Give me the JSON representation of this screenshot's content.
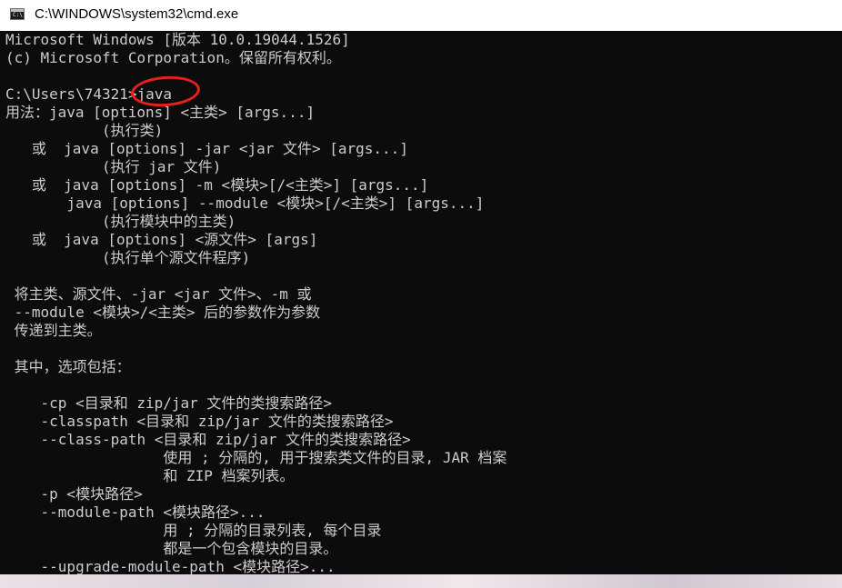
{
  "window": {
    "title": "C:\\WINDOWS\\system32\\cmd.exe",
    "icon": "cmd-icon",
    "icon_text": "C:\\"
  },
  "console": {
    "lines": [
      "Microsoft Windows [版本 10.0.19044.1526]",
      "(c) Microsoft Corporation。保留所有权利。",
      "",
      "C:\\Users\\74321>java",
      "用法：java [options] <主类> [args...]",
      "           (执行类)",
      "   或  java [options] -jar <jar 文件> [args...]",
      "           (执行 jar 文件)",
      "   或  java [options] -m <模块>[/<主类>] [args...]",
      "       java [options] --module <模块>[/<主类>] [args...]",
      "           (执行模块中的主类)",
      "   或  java [options] <源文件> [args]",
      "           (执行单个源文件程序)",
      "",
      " 将主类、源文件、-jar <jar 文件>、-m 或",
      " --module <模块>/<主类> 后的参数作为参数",
      " 传递到主类。",
      "",
      " 其中，选项包括：",
      "",
      "    -cp <目录和 zip/jar 文件的类搜索路径>",
      "    -classpath <目录和 zip/jar 文件的类搜索路径>",
      "    --class-path <目录和 zip/jar 文件的类搜索路径>",
      "                  使用 ; 分隔的, 用于搜索类文件的目录, JAR 档案",
      "                  和 ZIP 档案列表。",
      "    -p <模块路径>",
      "    --module-path <模块路径>...",
      "                  用 ; 分隔的目录列表, 每个目录",
      "                  都是一个包含模块的目录。",
      "    --upgrade-module-path <模块路径>..."
    ]
  },
  "annotation": {
    "color": "#e8201c"
  }
}
